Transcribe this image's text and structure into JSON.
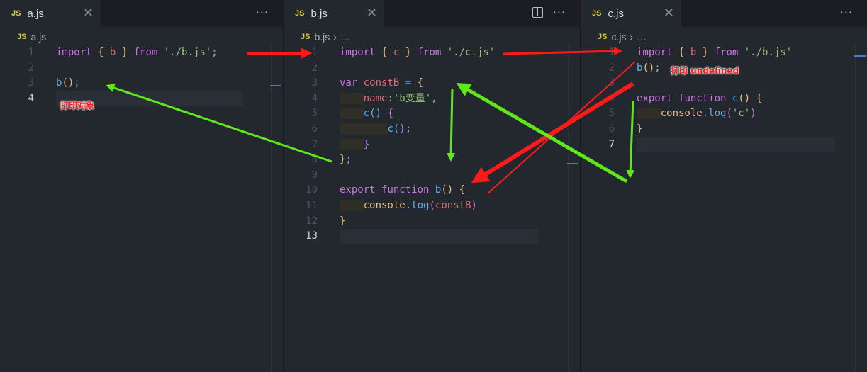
{
  "panes": [
    {
      "tab": "a.js",
      "crumb": "a.js",
      "crumb_more": "",
      "current_line": 4,
      "lines": [
        [
          [
            "import ",
            "k"
          ],
          [
            "{ ",
            "b"
          ],
          [
            "b ",
            "v"
          ],
          [
            "} ",
            "b"
          ],
          [
            "from ",
            "k"
          ],
          [
            "'./b.js'",
            "s"
          ],
          [
            ";",
            "p"
          ]
        ],
        [],
        [
          [
            "b",
            "f"
          ],
          [
            "()",
            "b"
          ],
          [
            ";",
            "p"
          ]
        ],
        []
      ]
    },
    {
      "tab": "b.js",
      "crumb": "b.js",
      "crumb_more": "…",
      "current_line": 13,
      "lines": [
        [
          [
            "import ",
            "k"
          ],
          [
            "{ ",
            "b"
          ],
          [
            "c ",
            "v"
          ],
          [
            "} ",
            "b"
          ],
          [
            "from ",
            "k"
          ],
          [
            "'./c.js'",
            "s"
          ]
        ],
        [],
        [
          [
            "var ",
            "k"
          ],
          [
            "constB ",
            "v"
          ],
          [
            "= ",
            "f"
          ],
          [
            "{",
            "b"
          ]
        ],
        [
          [
            "    ",
            "ind"
          ],
          [
            "name",
            "v"
          ],
          [
            ":",
            "p"
          ],
          [
            "'b变量'",
            "s"
          ],
          [
            ",",
            "p"
          ]
        ],
        [
          [
            "    ",
            "ind"
          ],
          [
            "c",
            "f"
          ],
          [
            "() ",
            "f"
          ],
          [
            "{",
            "k"
          ]
        ],
        [
          [
            "    ",
            "ind"
          ],
          [
            "    ",
            "ind"
          ],
          [
            "c",
            "f"
          ],
          [
            "()",
            "f"
          ],
          [
            ";",
            "p"
          ]
        ],
        [
          [
            "    ",
            "ind"
          ],
          [
            "}",
            "k"
          ]
        ],
        [
          [
            "}",
            "b"
          ],
          [
            ";",
            "p"
          ]
        ],
        [],
        [
          [
            "export ",
            "k"
          ],
          [
            "function ",
            "k"
          ],
          [
            "b",
            "f"
          ],
          [
            "() ",
            "b"
          ],
          [
            "{",
            "b"
          ]
        ],
        [
          [
            "    ",
            "ind"
          ],
          [
            "console",
            "c"
          ],
          [
            ".",
            "p"
          ],
          [
            "log",
            "f"
          ],
          [
            "(",
            "k"
          ],
          [
            "constB",
            "v"
          ],
          [
            ")",
            "k"
          ]
        ],
        [
          [
            "}",
            "b"
          ]
        ],
        []
      ]
    },
    {
      "tab": "c.js",
      "crumb": "c.js",
      "crumb_more": "…",
      "current_line": 7,
      "lines": [
        [
          [
            "import ",
            "k"
          ],
          [
            "{ ",
            "b"
          ],
          [
            "b ",
            "v"
          ],
          [
            "} ",
            "b"
          ],
          [
            "from ",
            "k"
          ],
          [
            "'./b.js'",
            "s"
          ]
        ],
        [
          [
            "b",
            "f"
          ],
          [
            "()",
            "b"
          ],
          [
            ";",
            "p"
          ]
        ],
        [],
        [
          [
            "export ",
            "k"
          ],
          [
            "function ",
            "k"
          ],
          [
            "c",
            "f"
          ],
          [
            "() ",
            "b"
          ],
          [
            "{",
            "b"
          ]
        ],
        [
          [
            "    ",
            "ind"
          ],
          [
            "console",
            "c"
          ],
          [
            ".",
            "p"
          ],
          [
            "log",
            "f"
          ],
          [
            "(",
            "k"
          ],
          [
            "'c'",
            "s"
          ],
          [
            ")",
            "k"
          ]
        ],
        [
          [
            "}",
            "b"
          ]
        ],
        []
      ]
    }
  ],
  "annotations": {
    "a_output": "打印对象",
    "c_output": "打印 undefined"
  },
  "colors": {
    "red_arrow": "#ff1a1a",
    "green_arrow": "#5ee81a"
  }
}
